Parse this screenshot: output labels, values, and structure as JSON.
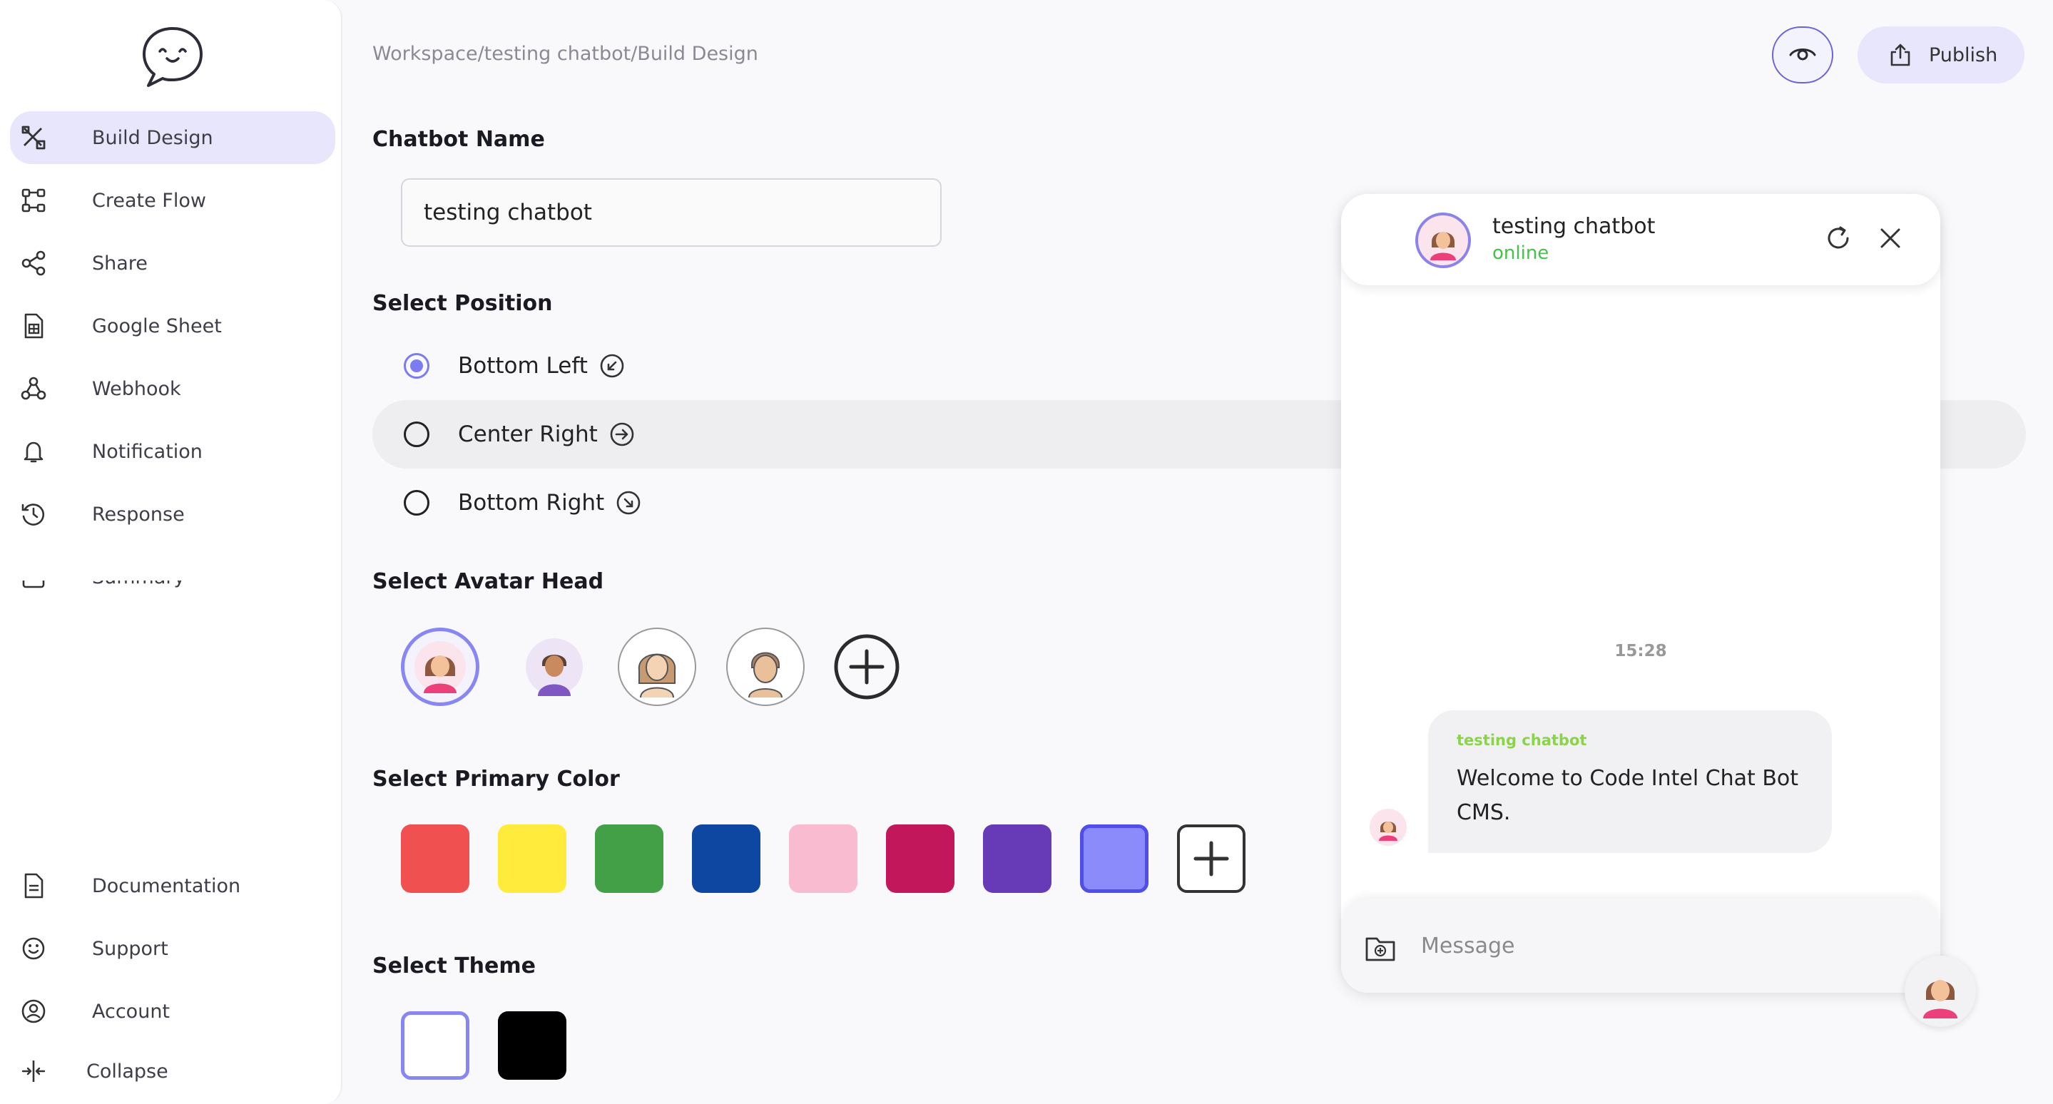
{
  "sidebar": {
    "items": [
      {
        "label": "Build Design",
        "icon": "build-design-icon",
        "active": true
      },
      {
        "label": "Create Flow",
        "icon": "flow-icon"
      },
      {
        "label": "Share",
        "icon": "share-icon"
      },
      {
        "label": "Google Sheet",
        "icon": "google-sheet-icon"
      },
      {
        "label": "Webhook",
        "icon": "webhook-icon"
      },
      {
        "label": "Notification",
        "icon": "bell-icon"
      },
      {
        "label": "Response",
        "icon": "response-icon"
      },
      {
        "label": "Summary",
        "icon": "summary-icon"
      }
    ],
    "bottom_items": [
      {
        "label": "Documentation",
        "icon": "document-icon"
      },
      {
        "label": "Support",
        "icon": "support-icon"
      },
      {
        "label": "Account",
        "icon": "account-icon"
      },
      {
        "label": "Collapse",
        "icon": "collapse-icon"
      }
    ]
  },
  "header": {
    "breadcrumb": "Workspace/testing chatbot/Build Design",
    "preview_icon": "eye-icon",
    "publish_label": "Publish"
  },
  "form": {
    "name_label": "Chatbot Name",
    "name_value": "testing chatbot",
    "position_label": "Select Position",
    "positions": [
      {
        "label": "Bottom Left",
        "selected": true,
        "icon": "arrow-down-left-icon"
      },
      {
        "label": "Center Right",
        "selected": false,
        "icon": "arrow-right-icon"
      },
      {
        "label": "Bottom Right",
        "selected": false,
        "icon": "arrow-down-right-icon"
      }
    ],
    "avatar_label": "Select Avatar Head",
    "avatars": [
      "woman-avatar",
      "man-avatar",
      "woman-sketch-avatar",
      "man-sketch-avatar"
    ],
    "color_label": "Select Primary Color",
    "colors": [
      "#f0504f",
      "#ffeb3b",
      "#43a047",
      "#0d47a1",
      "#f8bbd0",
      "#c2185b",
      "#673ab7",
      "#8c8bfb"
    ],
    "selected_color": "#8c8bfb",
    "theme_label": "Select Theme",
    "themes": [
      "#ffffff",
      "#000000"
    ],
    "selected_theme": "#ffffff"
  },
  "chat": {
    "bot_name": "testing chatbot",
    "status": "online",
    "time": "15:28",
    "sender": "testing chatbot",
    "message": "Welcome to Code Intel Chat Bot CMS.",
    "input_placeholder": "Message"
  },
  "colors": {
    "accent": "#7b7bf2",
    "online": "#46c24a",
    "sender": "#8bd44a",
    "active_nav": "#e7e6fc"
  }
}
